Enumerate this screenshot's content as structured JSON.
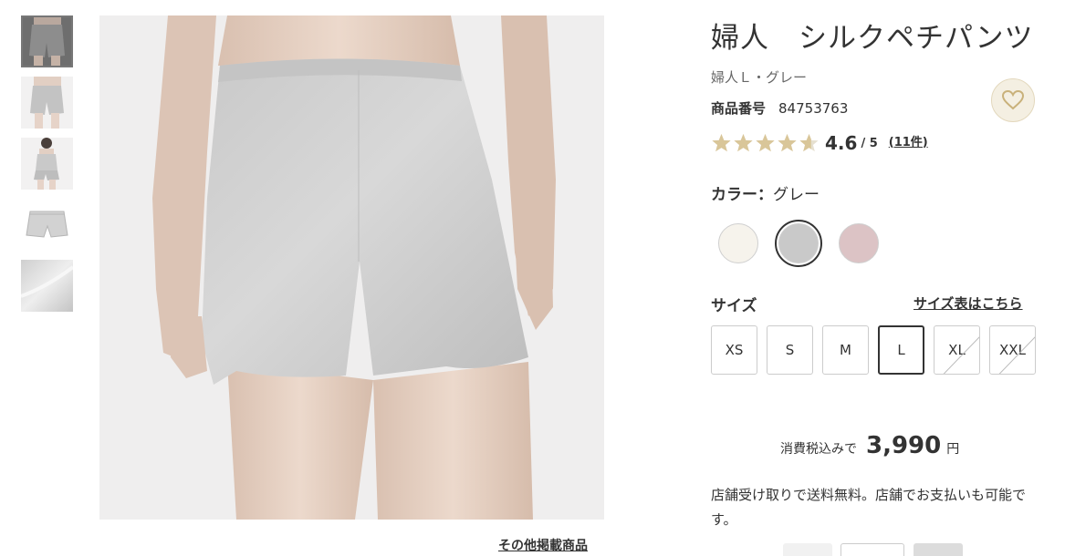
{
  "product": {
    "title": "婦人　シルクペチパンツ",
    "subtitle": "婦人Ｌ・グレー",
    "code_label": "商品番号",
    "code_value": "84753763"
  },
  "rating": {
    "value": "4.6",
    "max": "/ 5",
    "count": "(11件)",
    "stars_filled": 4.6
  },
  "color": {
    "label": "カラー：",
    "selected": "グレー",
    "swatches": [
      {
        "name": "off-white",
        "hex": "#f6f3ec",
        "selected": false
      },
      {
        "name": "gray",
        "hex": "#c9c9c9",
        "selected": true
      },
      {
        "name": "pink",
        "hex": "#dcc3c5",
        "selected": false
      }
    ]
  },
  "size": {
    "label": "サイズ",
    "chart_link": "サイズ表はこちら",
    "options": [
      {
        "label": "XS",
        "selected": false,
        "sold_out": false
      },
      {
        "label": "S",
        "selected": false,
        "sold_out": false
      },
      {
        "label": "M",
        "selected": false,
        "sold_out": false
      },
      {
        "label": "L",
        "selected": true,
        "sold_out": false
      },
      {
        "label": "XL",
        "selected": false,
        "sold_out": true
      },
      {
        "label": "XXL",
        "selected": false,
        "sold_out": true
      }
    ]
  },
  "price": {
    "tax_label": "消費税込みで",
    "amount": "3,990",
    "currency": "円"
  },
  "shipping_note": "店舗受け取りで送料無料。店舗でお支払いも可能です。",
  "gallery": {
    "other_items_link": "その他掲載商品",
    "thumbnails": [
      "thumb-model-back",
      "thumb-model-front",
      "thumb-model-camisole",
      "thumb-flat-lay",
      "thumb-fabric-closeup"
    ],
    "selected_thumbnail": 0
  },
  "colors": {
    "star_fill": "#d9c699",
    "star_empty": "#e6e0d0",
    "fav_bg": "#f4efe2",
    "fav_icon": "#c9b17a",
    "text": "#333333"
  }
}
